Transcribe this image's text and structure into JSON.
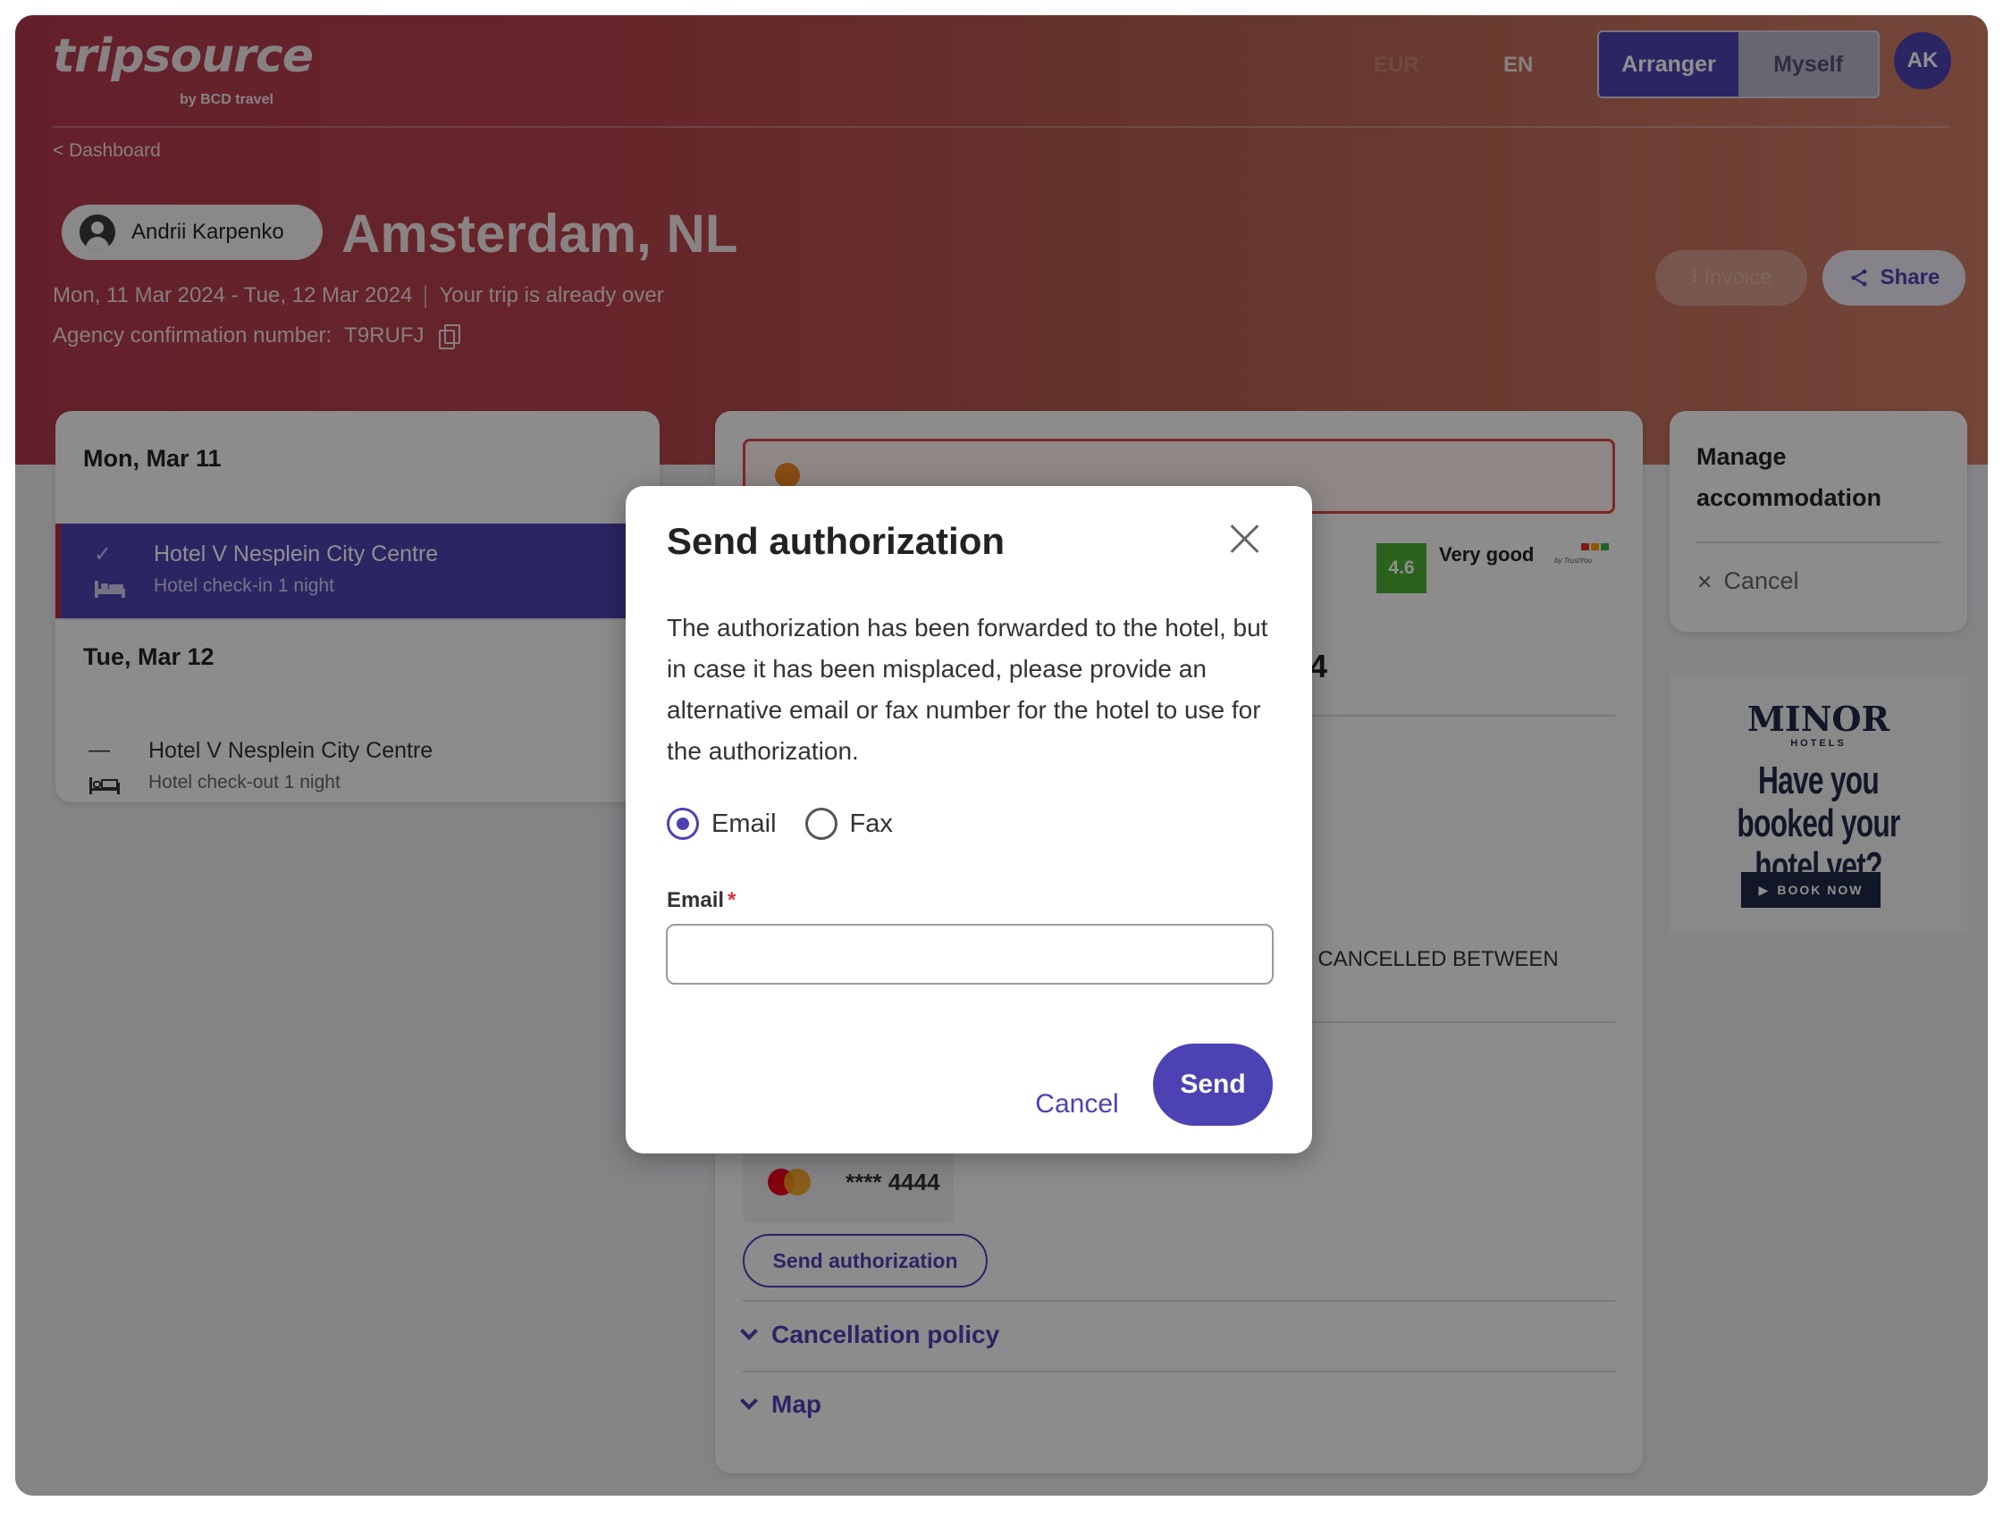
{
  "header": {
    "logo": "tripsource",
    "logo_byline": "by BCD travel",
    "currency": "EUR",
    "language": "EN",
    "roles": [
      "Arranger",
      "Myself"
    ],
    "active_role": "Arranger",
    "user_initials": "AK"
  },
  "trip": {
    "breadcrumb": "< Dashboard",
    "traveler": "Andrii Karpenko",
    "destination": "Amsterdam, NL",
    "dates": "Mon, 11 Mar 2024 - Tue, 12 Mar 2024",
    "status": "Your trip is already over",
    "agency_label": "Agency confirmation number:",
    "agency_code": "T9RUFJ",
    "invoice_label": "Invoice",
    "share_label": "Share"
  },
  "itinerary": {
    "days": [
      {
        "label": "Mon, Mar 11",
        "item": {
          "title": "Hotel V Nesplein City Centre",
          "subtitle": "Hotel check-in 1 night",
          "lead_icon": "✓"
        }
      },
      {
        "label": "Tue, Mar 12",
        "item": {
          "title": "Hotel V Nesplein City Centre",
          "subtitle": "Hotel check-out 1 night",
          "lead_icon": "—"
        }
      }
    ]
  },
  "details": {
    "rating_score": "4.6",
    "rating_label": "Very good",
    "rating_source": "by TrustYou",
    "price_fragment": "4",
    "cancel_fragment": "F CANCELLED BETWEEN",
    "card_number": "**** 4444",
    "send_authorization_label": "Send authorization",
    "accordions": [
      "Cancellation policy",
      "Map"
    ]
  },
  "manage": {
    "title": "Manage accommodation",
    "cancel_label": "Cancel"
  },
  "ad": {
    "brand": "MINOR",
    "brand_sub": "HOTELS",
    "headline": "Have you booked your hotel yet?",
    "cta": "BOOK NOW"
  },
  "modal": {
    "title": "Send authorization",
    "body": "The authorization has been forwarded to the hotel, but in case it has been misplaced, please provide an alternative email or fax number for the hotel to use for the authorization.",
    "options": [
      "Email",
      "Fax"
    ],
    "selected_option": "Email",
    "field_label": "Email",
    "required_marker": "*",
    "email_value": "",
    "cancel_label": "Cancel",
    "send_label": "Send"
  },
  "colors": {
    "brand_primary": "#4d42b3",
    "hero_start": "#b13a4f",
    "hero_end": "#cf7d67",
    "rating_green": "#4caf36",
    "alert_red": "#e0474c"
  }
}
